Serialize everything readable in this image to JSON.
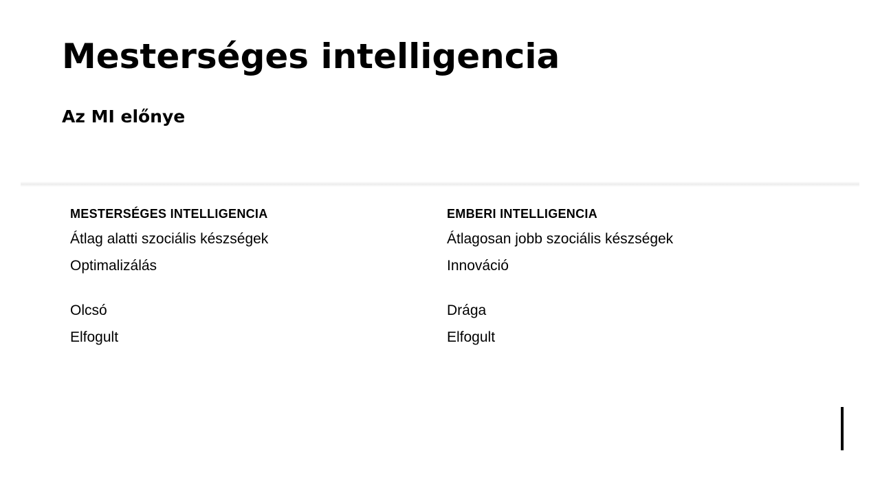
{
  "slide": {
    "title": "Mesterséges intelligencia",
    "subtitle": "Az MI előnye",
    "columns": [
      {
        "heading": "MESTERSÉGES INTELLIGENCIA",
        "items": [
          "Átlag alatti szociális készségek",
          "Optimalizálás",
          "Olcsó",
          "Elfogult"
        ]
      },
      {
        "heading": "EMBERI INTELLIGENCIA",
        "items": [
          "Átlagosan jobb szociális készségek",
          "Innováció",
          "Drága",
          "Elfogult"
        ]
      }
    ]
  }
}
